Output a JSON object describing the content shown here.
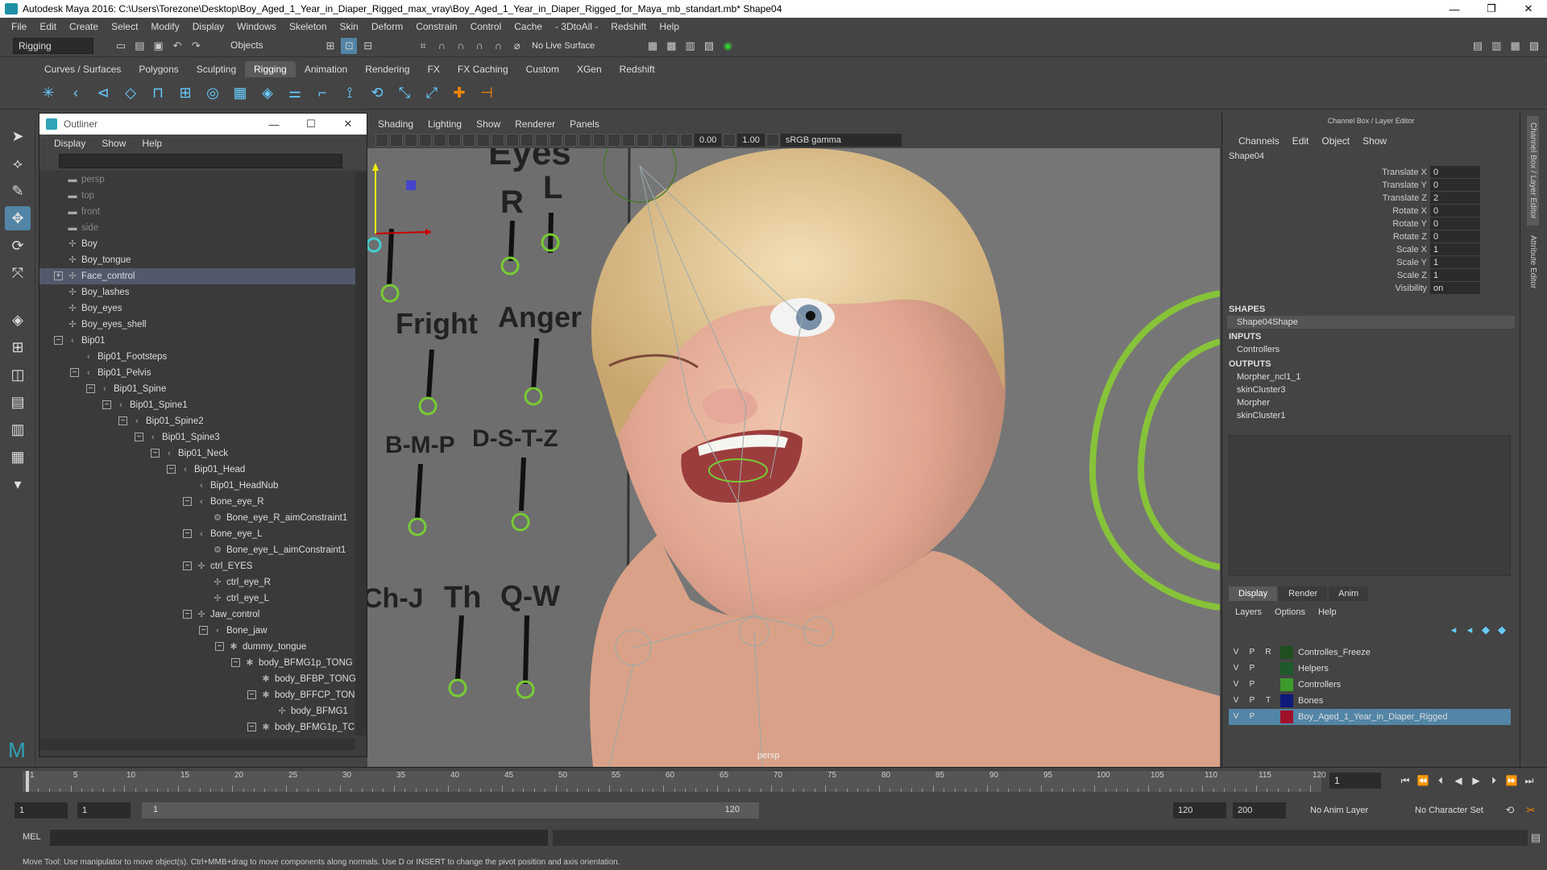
{
  "window": {
    "title": "Autodesk Maya 2016: C:\\Users\\Torezone\\Desktop\\Boy_Aged_1_Year_in_Diaper_Rigged_max_vray\\Boy_Aged_1_Year_in_Diaper_Rigged_for_Maya_mb_standart.mb*    Shape04",
    "min": "—",
    "max": "❐",
    "close": "✕"
  },
  "menubar": [
    "File",
    "Edit",
    "Create",
    "Select",
    "Modify",
    "Display",
    "Windows",
    "Skeleton",
    "Skin",
    "Deform",
    "Constrain",
    "Control",
    "Cache",
    "- 3DtoAll -",
    "Redshift",
    "Help"
  ],
  "status": {
    "mode": "Rigging",
    "objects": "Objects",
    "live": "No Live Surface"
  },
  "shelf_tabs": [
    "Curves / Surfaces",
    "Polygons",
    "Sculpting",
    "Rigging",
    "Animation",
    "Rendering",
    "FX",
    "FX Caching",
    "Custom",
    "XGen",
    "Redshift"
  ],
  "outliner": {
    "title": "Outliner",
    "menu": [
      "Display",
      "Show",
      "Help"
    ],
    "items": [
      {
        "label": "persp",
        "depth": 0,
        "icon": "camera",
        "dim": true
      },
      {
        "label": "top",
        "depth": 0,
        "icon": "camera",
        "dim": true
      },
      {
        "label": "front",
        "depth": 0,
        "icon": "camera",
        "dim": true
      },
      {
        "label": "side",
        "depth": 0,
        "icon": "camera",
        "dim": true
      },
      {
        "label": "Boy",
        "depth": 0,
        "icon": "mesh"
      },
      {
        "label": "Boy_tongue",
        "depth": 0,
        "icon": "mesh"
      },
      {
        "label": "Face_control",
        "depth": 0,
        "icon": "mesh",
        "exp": "+",
        "sel": true
      },
      {
        "label": "Boy_lashes",
        "depth": 0,
        "icon": "mesh"
      },
      {
        "label": "Boy_eyes",
        "depth": 0,
        "icon": "mesh"
      },
      {
        "label": "Boy_eyes_shell",
        "depth": 0,
        "icon": "mesh"
      },
      {
        "label": "Bip01",
        "depth": 0,
        "icon": "joint",
        "exp": "−"
      },
      {
        "label": "Bip01_Footsteps",
        "depth": 1,
        "icon": "joint"
      },
      {
        "label": "Bip01_Pelvis",
        "depth": 1,
        "icon": "joint",
        "exp": "−"
      },
      {
        "label": "Bip01_Spine",
        "depth": 2,
        "icon": "joint",
        "exp": "−"
      },
      {
        "label": "Bip01_Spine1",
        "depth": 3,
        "icon": "joint",
        "exp": "−"
      },
      {
        "label": "Bip01_Spine2",
        "depth": 4,
        "icon": "joint",
        "exp": "−"
      },
      {
        "label": "Bip01_Spine3",
        "depth": 5,
        "icon": "joint",
        "exp": "−"
      },
      {
        "label": "Bip01_Neck",
        "depth": 6,
        "icon": "joint",
        "exp": "−"
      },
      {
        "label": "Bip01_Head",
        "depth": 7,
        "icon": "joint",
        "exp": "−"
      },
      {
        "label": "Bip01_HeadNub",
        "depth": 8,
        "icon": "joint"
      },
      {
        "label": "Bone_eye_R",
        "depth": 8,
        "icon": "joint",
        "exp": "−"
      },
      {
        "label": "Bone_eye_R_aimConstraint1",
        "depth": 9,
        "icon": "constraint"
      },
      {
        "label": "Bone_eye_L",
        "depth": 8,
        "icon": "joint",
        "exp": "−"
      },
      {
        "label": "Bone_eye_L_aimConstraint1",
        "depth": 9,
        "icon": "constraint"
      },
      {
        "label": "ctrl_EYES",
        "depth": 8,
        "icon": "mesh",
        "exp": "−"
      },
      {
        "label": "ctrl_eye_R",
        "depth": 9,
        "icon": "mesh"
      },
      {
        "label": "ctrl_eye_L",
        "depth": 9,
        "icon": "mesh"
      },
      {
        "label": "Jaw_control",
        "depth": 8,
        "icon": "mesh",
        "exp": "−"
      },
      {
        "label": "Bone_jaw",
        "depth": 9,
        "icon": "joint",
        "exp": "−"
      },
      {
        "label": "dummy_tongue",
        "depth": 10,
        "icon": "star",
        "exp": "−"
      },
      {
        "label": "body_BFMG1p_TONG",
        "depth": 11,
        "icon": "star",
        "exp": "−"
      },
      {
        "label": "body_BFBP_TONG",
        "depth": 12,
        "icon": "star"
      },
      {
        "label": "body_BFFCP_TON",
        "depth": 12,
        "icon": "star",
        "exp": "−"
      },
      {
        "label": "body_BFMG1",
        "depth": 13,
        "icon": "mesh"
      },
      {
        "label": "body_BFMG1p_TC",
        "depth": 12,
        "icon": "star",
        "exp": "−"
      }
    ]
  },
  "viewport": {
    "menu": [
      "Shading",
      "Lighting",
      "Show",
      "Renderer",
      "Panels"
    ],
    "near": "0.00",
    "far": "1.00",
    "colorspace": "sRGB gamma",
    "camera_label": "persp",
    "face_controls": [
      "Eyes",
      "R",
      "L",
      "Fright",
      "Anger",
      "B-M-P",
      "D-S-T-Z",
      "Ch-J",
      "Th",
      "Q-W"
    ]
  },
  "channelbox": {
    "title": "Channel Box / Layer Editor",
    "menu": [
      "Channels",
      "Edit",
      "Object",
      "Show"
    ],
    "object": "Shape04",
    "attrs": [
      {
        "name": "Translate X",
        "value": "0"
      },
      {
        "name": "Translate Y",
        "value": "0"
      },
      {
        "name": "Translate Z",
        "value": "2"
      },
      {
        "name": "Rotate X",
        "value": "0"
      },
      {
        "name": "Rotate Y",
        "value": "0"
      },
      {
        "name": "Rotate Z",
        "value": "0"
      },
      {
        "name": "Scale X",
        "value": "1"
      },
      {
        "name": "Scale Y",
        "value": "1"
      },
      {
        "name": "Scale Z",
        "value": "1"
      },
      {
        "name": "Visibility",
        "value": "on"
      }
    ],
    "shapes_label": "SHAPES",
    "shape": "Shape04Shape",
    "inputs_label": "INPUTS",
    "inputs": [
      "Controllers"
    ],
    "outputs_label": "OUTPUTS",
    "outputs": [
      "Morpher_ncl1_1",
      "skinCluster3",
      "Morpher",
      "skinCluster1"
    ],
    "layer_tabs": [
      "Display",
      "Render",
      "Anim"
    ],
    "layer_menu": [
      "Layers",
      "Options",
      "Help"
    ],
    "layers": [
      {
        "v": "V",
        "p": "P",
        "r": "R",
        "name": "Controlles_Freeze",
        "color": "#1f4f1f"
      },
      {
        "v": "V",
        "p": "P",
        "r": "",
        "name": "Helpers",
        "color": "#1e5a2a"
      },
      {
        "v": "V",
        "p": "P",
        "r": "",
        "name": "Controllers",
        "color": "#3d9a2b"
      },
      {
        "v": "V",
        "p": "P",
        "r": "T",
        "name": "Bones",
        "color": "#0d1a7a"
      },
      {
        "v": "V",
        "p": "P",
        "r": "",
        "name": "Boy_Aged_1_Year_in_Diaper_Rigged",
        "color": "#a0102a",
        "sel": true
      }
    ]
  },
  "side_tabs": [
    "Channel Box / Layer Editor",
    "Attribute Editor"
  ],
  "timeline": {
    "ticks": [
      "1",
      "5",
      "10",
      "15",
      "20",
      "25",
      "30",
      "35",
      "40",
      "45",
      "50",
      "55",
      "60",
      "65",
      "70",
      "75",
      "80",
      "85",
      "90",
      "95",
      "100",
      "105",
      "110",
      "115",
      "120"
    ],
    "current_frame": "1"
  },
  "range": {
    "start": "1",
    "start2": "1",
    "slider_start": "1",
    "slider_end": "120",
    "end": "120",
    "end2": "200",
    "anim_layer": "No Anim Layer",
    "char_set": "No Character Set"
  },
  "cmd": {
    "label": "MEL"
  },
  "help": "Move Tool: Use manipulator to move object(s). Ctrl+MMB+drag to move components along normals. Use D or INSERT to change the pivot position and axis orientation."
}
